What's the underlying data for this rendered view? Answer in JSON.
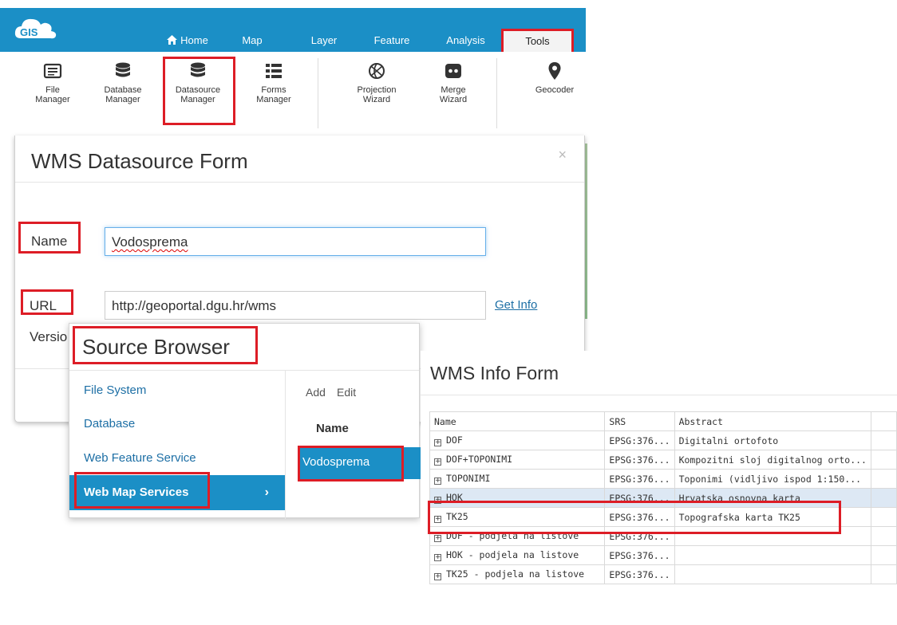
{
  "app": {
    "logo_text": "GIS",
    "nav": [
      "Home",
      "Map",
      "Layer",
      "Feature",
      "Analysis",
      "Tools"
    ],
    "ribbon": [
      {
        "line1": "File",
        "line2": "Manager",
        "icon": "file-manager-icon"
      },
      {
        "line1": "Database",
        "line2": "Manager",
        "icon": "database-icon"
      },
      {
        "line1": "Datasource",
        "line2": "Manager",
        "icon": "datasource-icon"
      },
      {
        "line1": "Forms",
        "line2": "Manager",
        "icon": "forms-list-icon"
      },
      {
        "line1": "Projection",
        "line2": "Wizard",
        "icon": "globe-projection-icon"
      },
      {
        "line1": "Merge",
        "line2": "Wizard",
        "icon": "merge-icon"
      },
      {
        "line1": "Geocoder",
        "line2": "",
        "icon": "map-pin-icon"
      }
    ],
    "accent": "#1b8fc6",
    "highlight": "#dd1d26"
  },
  "datasource_form": {
    "title": "WMS Datasource Form",
    "close": "×",
    "name_label": "Name",
    "name_value": "Vodosprema",
    "url_label": "URL",
    "url_value": "http://geoportal.dgu.hr/wms",
    "get_info": "Get Info",
    "version_label": "Versio"
  },
  "source_browser": {
    "title": "Source Browser",
    "items": [
      "File System",
      "Database",
      "Web Feature Service",
      "Web Map Services"
    ],
    "chevron": "›",
    "toolbar": {
      "add": "Add",
      "edit": "Edit"
    },
    "column": "Name",
    "row": "Vodosprema"
  },
  "wms_info": {
    "title": "WMS Info Form",
    "columns": [
      "Name",
      "SRS",
      "Abstract"
    ],
    "rows": [
      {
        "name": "DOF",
        "srs": "EPSG:376...",
        "abstract": "Digitalni ortofoto"
      },
      {
        "name": "DOF+TOPONIMI",
        "srs": "EPSG:376...",
        "abstract": "Kompozitni sloj digitalnog orto..."
      },
      {
        "name": "TOPONIMI",
        "srs": "EPSG:376...",
        "abstract": "Toponimi (vidljivo ispod 1:150..."
      },
      {
        "name": "HOK",
        "srs": "EPSG:376...",
        "abstract": "Hrvatska osnovna karta"
      },
      {
        "name": "TK25",
        "srs": "EPSG:376...",
        "abstract": "Topografska karta TK25"
      },
      {
        "name": "DOF - podjela na listove",
        "srs": "EPSG:376...",
        "abstract": ""
      },
      {
        "name": "HOK - podjela na listove",
        "srs": "EPSG:376...",
        "abstract": ""
      },
      {
        "name": "TK25 - podjela na listove",
        "srs": "EPSG:376...",
        "abstract": ""
      }
    ],
    "selected_row": "HOK"
  }
}
